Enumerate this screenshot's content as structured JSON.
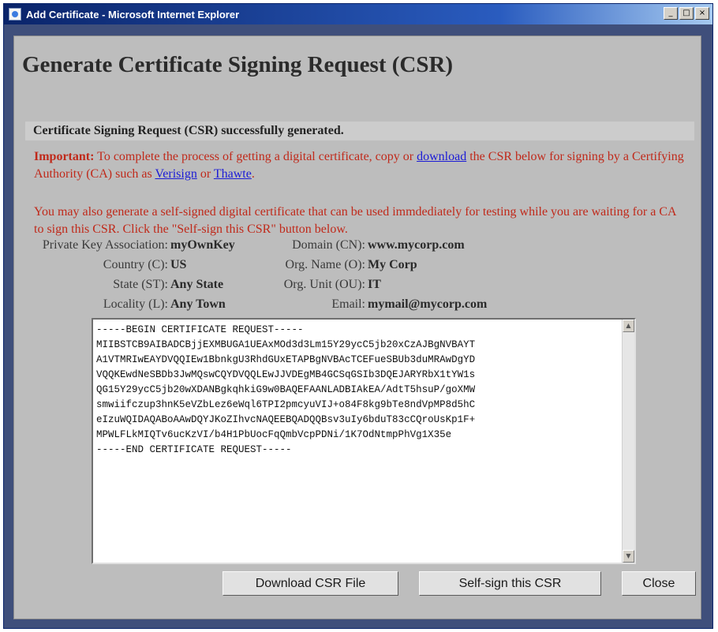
{
  "window": {
    "title": "Add Certificate - Microsoft Internet Explorer",
    "controls": {
      "minimize": "_",
      "maximize": "□",
      "close": "×"
    }
  },
  "page": {
    "title": "Generate Certificate Signing Request (CSR)",
    "status": "Certificate Signing Request (CSR) successfully generated."
  },
  "important": {
    "label": "Important:",
    "text1": "To complete the process of getting a digital certificate, copy or",
    "link_download": "download",
    "text2": "the CSR below for signing by a Certifying Authority (CA) such as",
    "link_verisign": "Verisign",
    "text3": "or",
    "link_thawte": "Thawte",
    "text4": "."
  },
  "selfsign_note": "You may also generate a self-signed digital certificate that can be used immdediately for testing while you are waiting for a CA to sign this CSR. Click the \"Self-sign this CSR\" button below.",
  "details": {
    "private_key": {
      "label": "Private Key Association:",
      "value": "myOwnKey"
    },
    "country": {
      "label": "Country (C):",
      "value": "US"
    },
    "state": {
      "label": "State (ST):",
      "value": "Any State"
    },
    "locality": {
      "label": "Locality (L):",
      "value": "Any Town"
    },
    "domain": {
      "label": "Domain (CN):",
      "value": "www.mycorp.com"
    },
    "org_name": {
      "label": "Org. Name (O):",
      "value": "My Corp"
    },
    "org_unit": {
      "label": "Org. Unit (OU):",
      "value": "IT"
    },
    "email": {
      "label": "Email:",
      "value": "mymail@mycorp.com"
    }
  },
  "csr_text": "-----BEGIN CERTIFICATE REQUEST-----\nMIIBSTCB9AIBADCBjjEXMBUGA1UEAxMOd3d3Lm15Y29ycC5jb20xCzAJBgNVBAYT\nA1VTMRIwEAYDVQQIEw1BbnkgU3RhdGUxETAPBgNVBAcTCEFueSBUb3duMRAwDgYD\nVQQKEwdNeSBDb3JwMQswCQYDVQQLEwJJVDEgMB4GCSqGSIb3DQEJARYRbX1tYW1s\nQG15Y29ycC5jb20wXDANBgkqhkiG9w0BAQEFAANLADBIAkEA/AdtT5hsuP/goXMW\nsmwiifczup3hnK5eVZbLez6eWql6TPI2pmcyuVIJ+o84F8kg9bTe8ndVpMP8d5hC\neIzuWQIDAQABoAAwDQYJKoZIhvcNAQEEBQADQQBsv3uIy6bduT83cCQroUsKp1F+\nMPWLFLkMIQTv6ucKzVI/b4H1PbUocFqQmbVcpPDNi/1K7OdNtmpPhVg1X35e\n-----END CERTIFICATE REQUEST-----",
  "buttons": {
    "download": "Download CSR File",
    "selfsign": "Self-sign this CSR",
    "close": "Close"
  },
  "scrollbar": {
    "up": "▲",
    "down": "▼"
  }
}
